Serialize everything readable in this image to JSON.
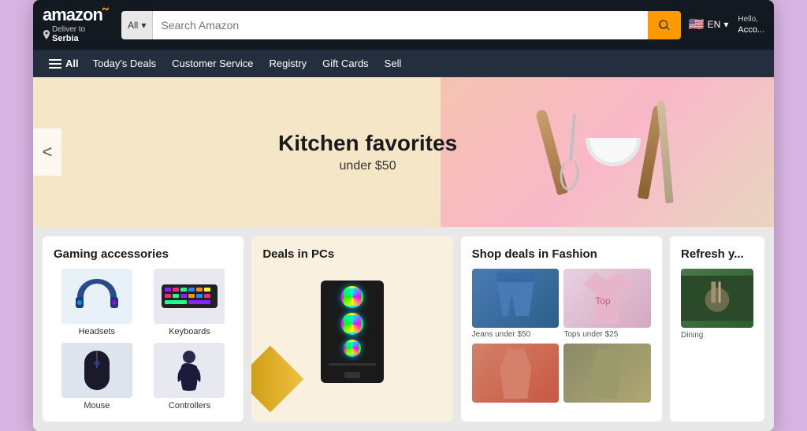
{
  "header": {
    "logo": "amazon",
    "smile_color": "#FF9900",
    "deliver_label": "Deliver to",
    "location": "Serbia",
    "search_category": "All",
    "search_placeholder": "Search Amazon",
    "search_button_label": "Search",
    "lang": "EN",
    "account_hello": "Hello,",
    "account_label": "Acco..."
  },
  "nav": {
    "all_label": "All",
    "items": [
      {
        "label": "Today's Deals"
      },
      {
        "label": "Customer Service"
      },
      {
        "label": "Registry"
      },
      {
        "label": "Gift Cards"
      },
      {
        "label": "Sell"
      }
    ]
  },
  "hero": {
    "title": "Kitchen favorites",
    "subtitle": "under ",
    "price": "$50",
    "prev_arrow": "<"
  },
  "cards": [
    {
      "id": "gaming",
      "title": "Gaming accessories",
      "items": [
        {
          "label": "Headsets"
        },
        {
          "label": "Keyboards"
        },
        {
          "label": "Mouse"
        },
        {
          "label": "Controllers"
        }
      ]
    },
    {
      "id": "pcs",
      "title": "Deals in PCs"
    },
    {
      "id": "fashion",
      "title": "Shop deals in Fashion",
      "items": [
        {
          "label": "Jeans under $50"
        },
        {
          "label": "Tops under $25"
        },
        {
          "label": ""
        },
        {
          "label": ""
        }
      ]
    },
    {
      "id": "refresh",
      "title": "Refresh y...",
      "items": [
        {
          "label": "Dining"
        }
      ]
    }
  ]
}
